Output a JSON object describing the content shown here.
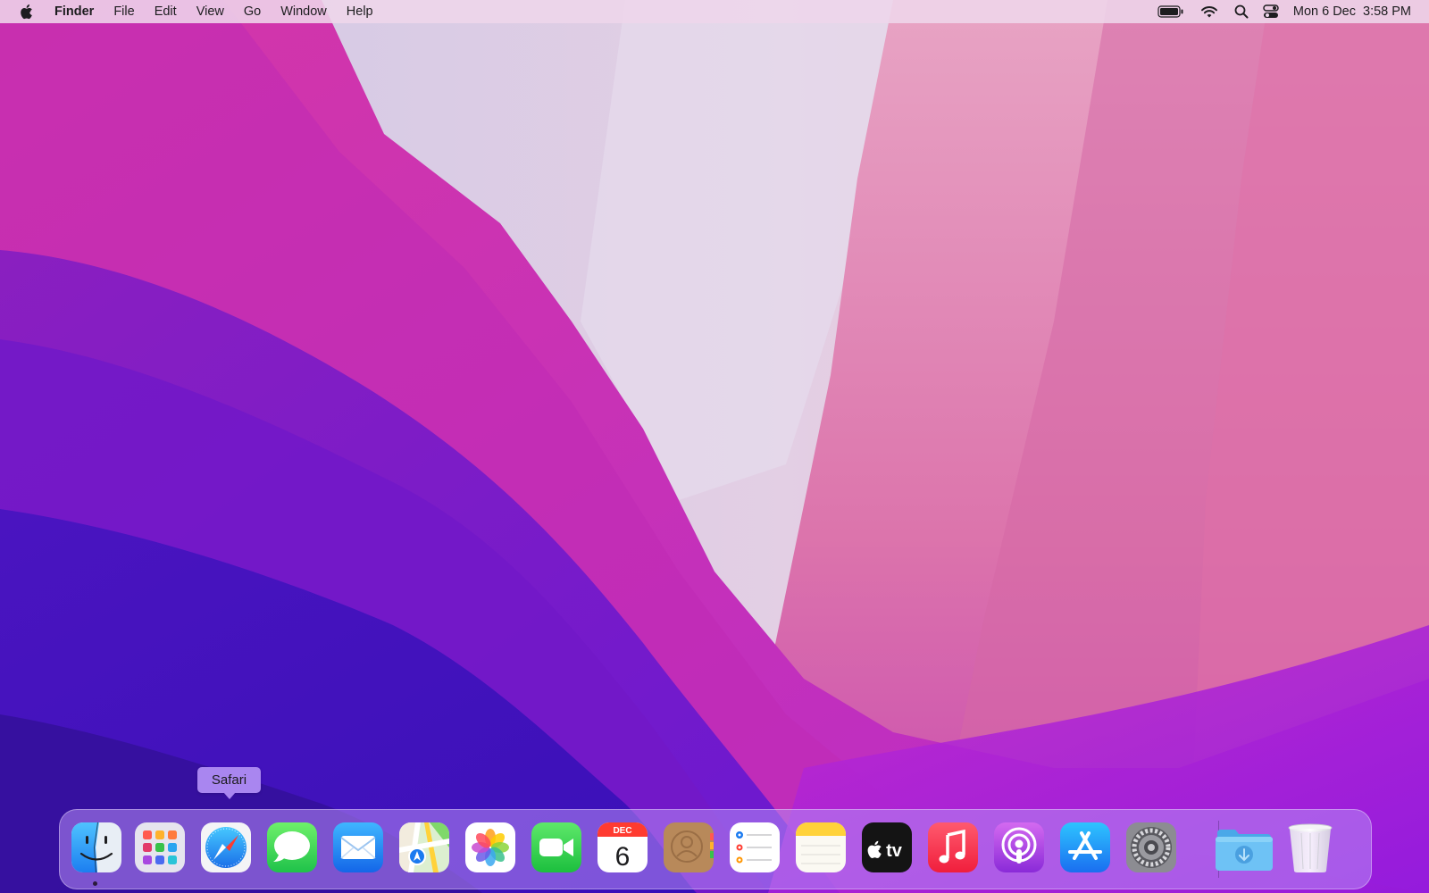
{
  "menubar": {
    "apple_icon": "apple-logo-icon",
    "app_name": "Finder",
    "items": [
      "File",
      "Edit",
      "View",
      "Go",
      "Window",
      "Help"
    ],
    "status_icons": [
      "battery-icon",
      "wifi-icon",
      "spotlight-search-icon",
      "control-center-icon"
    ],
    "clock": {
      "date": "Mon 6 Dec",
      "time": "3:58 PM"
    }
  },
  "tooltip": {
    "label": "Safari"
  },
  "dock": {
    "apps": [
      {
        "name": "Finder",
        "icon": "finder-icon",
        "running": true
      },
      {
        "name": "Launchpad",
        "icon": "launchpad-icon"
      },
      {
        "name": "Safari",
        "icon": "safari-icon"
      },
      {
        "name": "Messages",
        "icon": "messages-icon"
      },
      {
        "name": "Mail",
        "icon": "mail-icon"
      },
      {
        "name": "Maps",
        "icon": "maps-icon"
      },
      {
        "name": "Photos",
        "icon": "photos-icon"
      },
      {
        "name": "FaceTime",
        "icon": "facetime-icon"
      },
      {
        "name": "Calendar",
        "icon": "calendar-icon",
        "month": "DEC",
        "day": "6"
      },
      {
        "name": "Contacts",
        "icon": "contacts-icon"
      },
      {
        "name": "Reminders",
        "icon": "reminders-icon"
      },
      {
        "name": "Notes",
        "icon": "notes-icon"
      },
      {
        "name": "TV",
        "icon": "apple-tv-icon",
        "text": "tv"
      },
      {
        "name": "Music",
        "icon": "music-icon"
      },
      {
        "name": "Podcasts",
        "icon": "podcasts-icon"
      },
      {
        "name": "App Store",
        "icon": "app-store-icon"
      },
      {
        "name": "System Preferences",
        "icon": "system-preferences-icon"
      }
    ],
    "stacks": [
      {
        "name": "Downloads",
        "icon": "downloads-folder-icon"
      },
      {
        "name": "Trash",
        "icon": "trash-icon"
      }
    ]
  },
  "colors": {
    "menubar_bg": "#eed6eb",
    "dock_bg": "#b78cf5",
    "tooltip_bg": "#a986f0"
  }
}
